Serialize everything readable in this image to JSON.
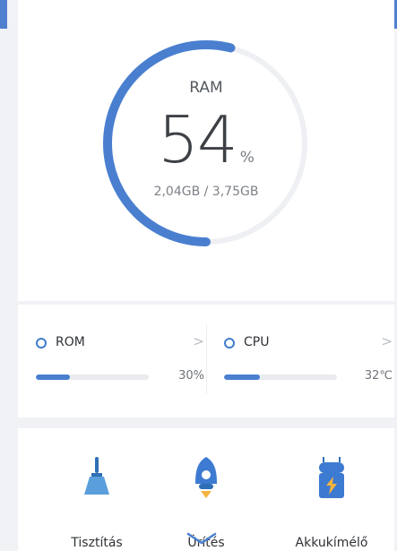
{
  "ram": {
    "label": "RAM",
    "percent": "54",
    "percent_unit": "%",
    "usage": "2,04GB / 3,75GB",
    "level": 0.54
  },
  "stats": [
    {
      "label": "ROM",
      "value": "30%",
      "level": 0.3
    },
    {
      "label": "CPU",
      "value": "32℃",
      "level": 0.32
    }
  ],
  "tools": [
    {
      "label": "Tisztítás",
      "icon": "broom-icon"
    },
    {
      "label": "Ürítés",
      "icon": "rocket-icon"
    },
    {
      "label": "Akkukímélő",
      "icon": "battery-android-icon"
    }
  ],
  "colors": {
    "accent": "#4a7fd0",
    "track": "#eef0f3"
  }
}
